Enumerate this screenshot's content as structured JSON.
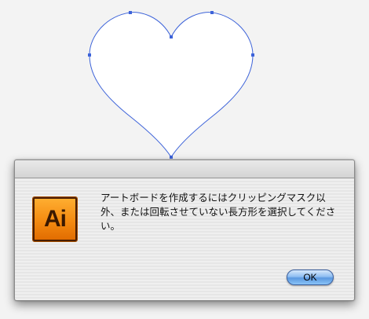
{
  "canvas": {
    "shape": "heart",
    "fill_color": "#ffffff",
    "path_color": "#3d63d9",
    "anchor_color": "#3d63d9"
  },
  "dialog": {
    "icon_name": "adobe-illustrator-app-icon",
    "icon_text": "Ai",
    "message": "アートボードを作成するにはクリッピングマスク以外、または回転させていない長方形を選択してください。",
    "ok_label": "OK",
    "accent_color": "#5a98e0"
  }
}
